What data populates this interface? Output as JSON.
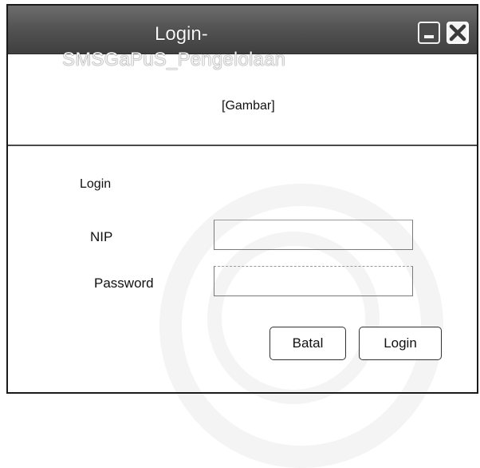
{
  "window": {
    "title_line1": "Login-",
    "title_line2": "SMSGaPuS_Pengelolaan",
    "minimize_icon": "minimize-icon",
    "close_icon": "close-icon"
  },
  "header": {
    "image_placeholder": "[Gambar]"
  },
  "form": {
    "section_label": "Login",
    "nip_label": "NIP",
    "nip_value": "",
    "password_label": "Password",
    "password_value": ""
  },
  "buttons": {
    "cancel_label": "Batal",
    "login_label": "Login"
  },
  "colors": {
    "titlebar": "#545454",
    "border": "#1a1a1a",
    "background": "#ffffff"
  }
}
